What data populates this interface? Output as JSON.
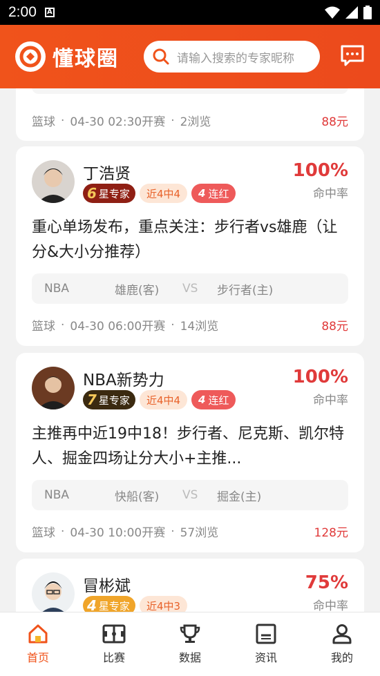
{
  "status": {
    "time": "2:00"
  },
  "header": {
    "brand": "懂球圈",
    "search_placeholder": "请输入搜索的专家昵称"
  },
  "cards": [
    {
      "sport": "篮球",
      "time": "04-30 02:30开赛",
      "views": "2浏览",
      "price": "88元"
    },
    {
      "name": "丁浩贤",
      "stars": "6",
      "star_label": "星专家",
      "near": "近4中4",
      "streak_num": "4",
      "streak_label": "连红",
      "rate": "100%",
      "rate_label": "命中率",
      "title": "重心单场发布，重点关注：步行者vs雄鹿（让分&大小分推荐）",
      "league": "NBA",
      "away": "雄鹿(客)",
      "vs": "VS",
      "home": "步行者(主)",
      "sport": "篮球",
      "time": "04-30 06:00开赛",
      "views": "14浏览",
      "price": "88元"
    },
    {
      "name": "NBA新势力",
      "stars": "7",
      "star_label": "星专家",
      "near": "近4中4",
      "streak_num": "4",
      "streak_label": "连红",
      "rate": "100%",
      "rate_label": "命中率",
      "title": "主推再中近19中18！步行者、尼克斯、凯尔特人、掘金四场让分大小+主推...",
      "league": "NBA",
      "away": "快船(客)",
      "vs": "VS",
      "home": "掘金(主)",
      "sport": "篮球",
      "time": "04-30 10:00开赛",
      "views": "57浏览",
      "price": "128元"
    },
    {
      "name": "冒彬斌",
      "stars": "4",
      "star_label": "星专家",
      "near": "近4中3",
      "rate": "75%",
      "rate_label": "命中率"
    }
  ],
  "tabs": [
    {
      "label": "首页",
      "icon": "home-icon"
    },
    {
      "label": "比赛",
      "icon": "court-icon"
    },
    {
      "label": "数据",
      "icon": "trophy-icon"
    },
    {
      "label": "资讯",
      "icon": "news-icon"
    },
    {
      "label": "我的",
      "icon": "user-icon"
    }
  ],
  "colors": {
    "brand": "#f0531b",
    "price": "#e03a3a"
  }
}
